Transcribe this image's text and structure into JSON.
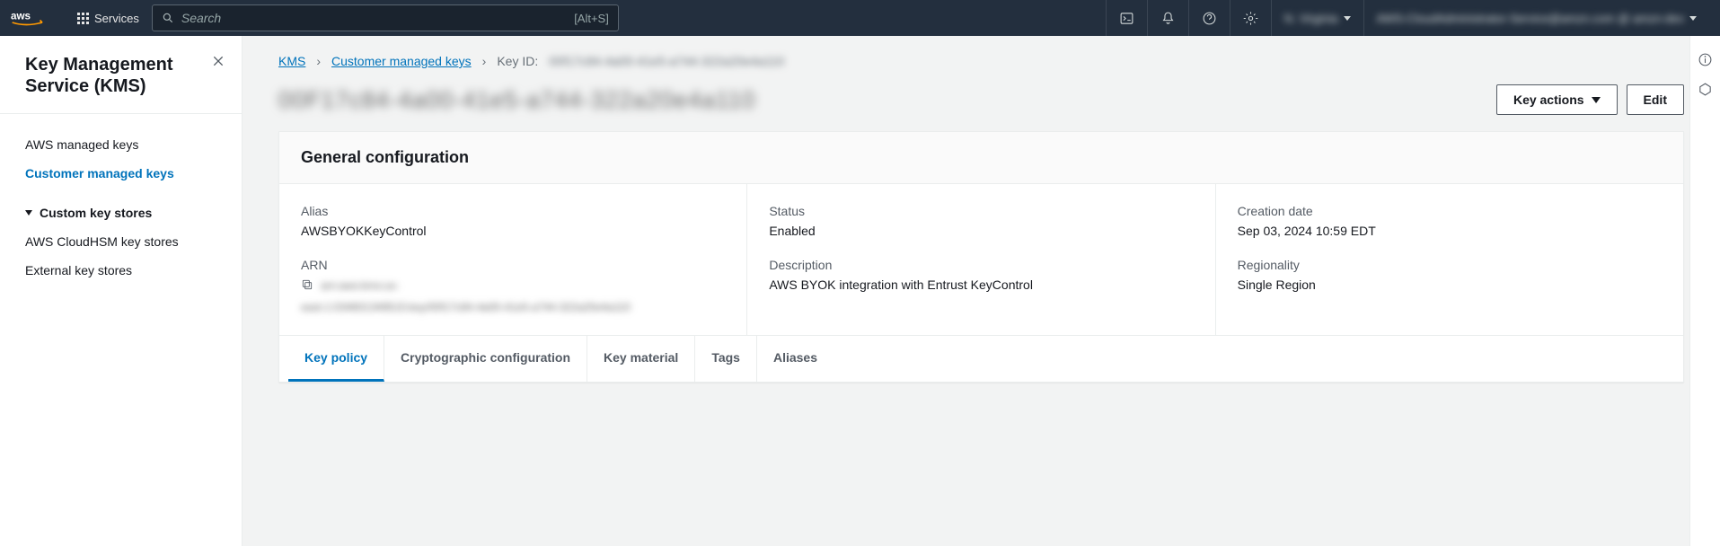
{
  "topnav": {
    "services_label": "Services",
    "search_placeholder": "Search",
    "search_shortcut": "[Alt+S]",
    "region_label": "N. Virginia",
    "account_label": "AWS-CloudAdministrator-Service@amzn.com @ amzn-dev"
  },
  "sidebar": {
    "title": "Key Management Service (KMS)",
    "items": [
      {
        "label": "AWS managed keys",
        "active": false
      },
      {
        "label": "Customer managed keys",
        "active": true
      }
    ],
    "group_label": "Custom key stores",
    "group_items": [
      {
        "label": "AWS CloudHSM key stores"
      },
      {
        "label": "External key stores"
      }
    ]
  },
  "breadcrumbs": {
    "root": "KMS",
    "l1": "Customer managed keys",
    "l2_label": "Key ID:",
    "l2_value": "00f17c84-4a00-41e5-a744-322a20e4a110"
  },
  "page_title_blur": "00F17c84-4a00-41e5-a744-322a20e4a110",
  "actions": {
    "key_actions": "Key actions",
    "edit": "Edit"
  },
  "panel": {
    "title": "General configuration",
    "alias_label": "Alias",
    "alias_value": "AWSBYOKKeyControl",
    "arn_label": "ARN",
    "arn_short": "arn:aws:kms:us-",
    "arn_value": "east-1:034601349515:key/00f17c84-4a00-41e5-a744-322a20e4a110",
    "status_label": "Status",
    "status_value": "Enabled",
    "description_label": "Description",
    "description_value": "AWS BYOK integration with Entrust KeyControl",
    "creation_label": "Creation date",
    "creation_value": "Sep 03, 2024 10:59 EDT",
    "regionality_label": "Regionality",
    "regionality_value": "Single Region"
  },
  "tabs": [
    {
      "label": "Key policy",
      "active": true
    },
    {
      "label": "Cryptographic configuration",
      "active": false
    },
    {
      "label": "Key material",
      "active": false
    },
    {
      "label": "Tags",
      "active": false
    },
    {
      "label": "Aliases",
      "active": false
    }
  ]
}
